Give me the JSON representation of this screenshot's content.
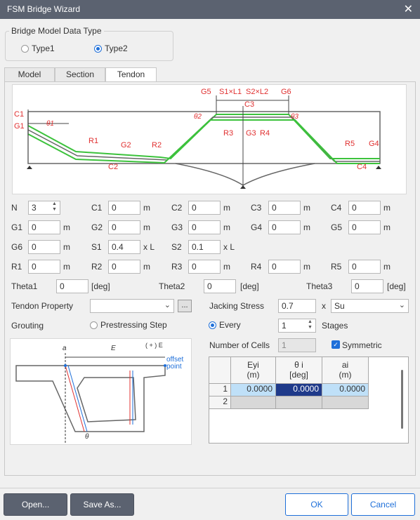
{
  "window": {
    "title": "FSM Bridge Wizard"
  },
  "data_type": {
    "group_title": "Bridge Model Data Type",
    "type1": "Type1",
    "type2": "Type2"
  },
  "tabs": [
    "Model",
    "Section",
    "Tendon"
  ],
  "diagram": {
    "labels": {
      "g5": "G5",
      "s1l1": "S1×L1",
      "s2l2": "S2×L2",
      "g6": "G6",
      "c3": "C3",
      "c1": "C1",
      "g1": "G1",
      "th1": "θ1",
      "th2": "θ2",
      "th3": "θ3",
      "r1": "R1",
      "g2": "G2",
      "r2": "R2",
      "c2": "C2",
      "r3": "R3",
      "g3": "G3",
      "r4": "R4",
      "r5": "R5",
      "g4": "G4",
      "c4": "C4"
    }
  },
  "fields": {
    "n": {
      "label": "N",
      "value": "3"
    },
    "c1": {
      "label": "C1",
      "value": "0",
      "unit": "m"
    },
    "c2": {
      "label": "C2",
      "value": "0",
      "unit": "m"
    },
    "c3": {
      "label": "C3",
      "value": "0",
      "unit": "m"
    },
    "c4": {
      "label": "C4",
      "value": "0",
      "unit": "m"
    },
    "g1": {
      "label": "G1",
      "value": "0",
      "unit": "m"
    },
    "g2": {
      "label": "G2",
      "value": "0",
      "unit": "m"
    },
    "g3": {
      "label": "G3",
      "value": "0",
      "unit": "m"
    },
    "g4": {
      "label": "G4",
      "value": "0",
      "unit": "m"
    },
    "g5": {
      "label": "G5",
      "value": "0",
      "unit": "m"
    },
    "g6": {
      "label": "G6",
      "value": "0",
      "unit": "m"
    },
    "s1": {
      "label": "S1",
      "value": "0.4",
      "unit": "x L"
    },
    "s2": {
      "label": "S2",
      "value": "0.1",
      "unit": "x L"
    },
    "r1": {
      "label": "R1",
      "value": "0",
      "unit": "m"
    },
    "r2": {
      "label": "R2",
      "value": "0",
      "unit": "m"
    },
    "r3": {
      "label": "R3",
      "value": "0",
      "unit": "m"
    },
    "r4": {
      "label": "R4",
      "value": "0",
      "unit": "m"
    },
    "r5": {
      "label": "R5",
      "value": "0",
      "unit": "m"
    },
    "theta1": {
      "label": "Theta1",
      "value": "0",
      "unit": "[deg]"
    },
    "theta2": {
      "label": "Theta2",
      "value": "0",
      "unit": "[deg]"
    },
    "theta3": {
      "label": "Theta3",
      "value": "0",
      "unit": "[deg]"
    }
  },
  "tendon_property": {
    "label": "Tendon Property",
    "value": "",
    "browse": "..."
  },
  "jacking": {
    "label": "Jacking Stress",
    "value": "0.7",
    "x": "x",
    "combo": "Su"
  },
  "grouting": {
    "label": "Grouting",
    "opt1": "Prestressing Step",
    "opt2": "Every",
    "stages_value": "1",
    "stages_label": "Stages"
  },
  "cells": {
    "label": "Number of Cells",
    "value": "1",
    "symmetric": "Symmetric"
  },
  "diag2": {
    "ai": "a",
    "ei": "E",
    "plus_e": "( + ) E",
    "offset": "offset",
    "point": "point",
    "theta": "θ"
  },
  "grid": {
    "headers": [
      [
        "Eyi",
        "(m)"
      ],
      [
        "θ i",
        "[deg]"
      ],
      [
        "ai",
        "(m)"
      ]
    ],
    "rows": [
      {
        "n": "1",
        "cells": [
          "0.0000",
          "0.0000",
          "0.0000"
        ]
      },
      {
        "n": "2",
        "cells": [
          "",
          "",
          ""
        ]
      }
    ]
  },
  "buttons": {
    "open": "Open...",
    "save_as": "Save As...",
    "ok": "OK",
    "cancel": "Cancel"
  },
  "colors": {
    "accent": "#1e6fd9",
    "title_bar": "#5b6270",
    "label_red": "#e03030",
    "tendon_green": "#3cc23c"
  }
}
